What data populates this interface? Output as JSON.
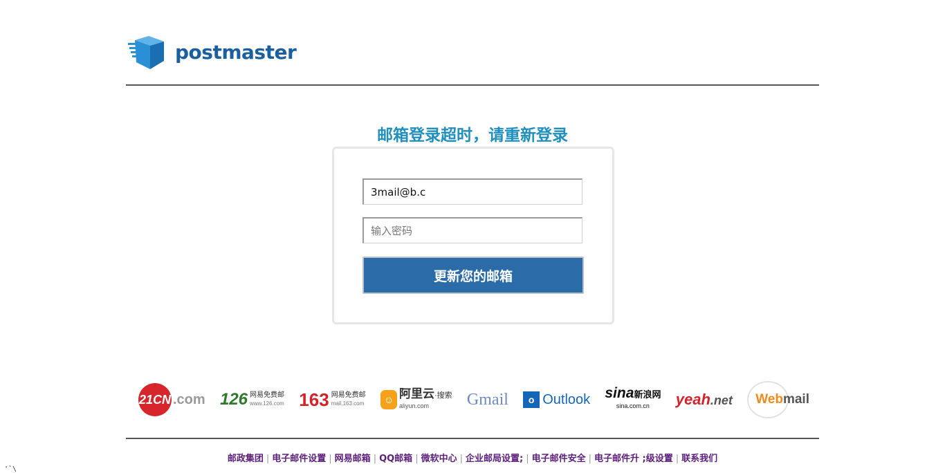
{
  "brand": {
    "name": "postmaster"
  },
  "notice": "邮箱登录超时，请重新登录",
  "form": {
    "email_value": "3mail@b.c",
    "password_placeholder": "输入密码",
    "submit_label": "更新您的邮箱"
  },
  "providers": [
    {
      "name": "21CN",
      "suffix": ".com"
    },
    {
      "name": "126",
      "sub": "网易免费邮",
      "url": "www.126.com"
    },
    {
      "name": "163",
      "sub": "网易免费邮",
      "url": "mail.163.com"
    },
    {
      "name": "阿里云",
      "tag": "·搜索",
      "url": "aliyun.com"
    },
    {
      "name": "Gmail"
    },
    {
      "name": "Outlook"
    },
    {
      "name": "sina",
      "tag": "新浪网",
      "url": "sina.com.cn"
    },
    {
      "name": "yeah",
      "suffix": ".net"
    },
    {
      "name": "Web",
      "suffix": "mail"
    }
  ],
  "footer": {
    "links": [
      "邮政集团",
      "电子邮件设置",
      "网易邮箱",
      "QQ邮箱",
      "微软中心",
      "企业邮局设置;",
      "电子邮件安全",
      "电子邮件升 ;级设置",
      "联系我们"
    ]
  },
  "stray_text": "'`\\"
}
